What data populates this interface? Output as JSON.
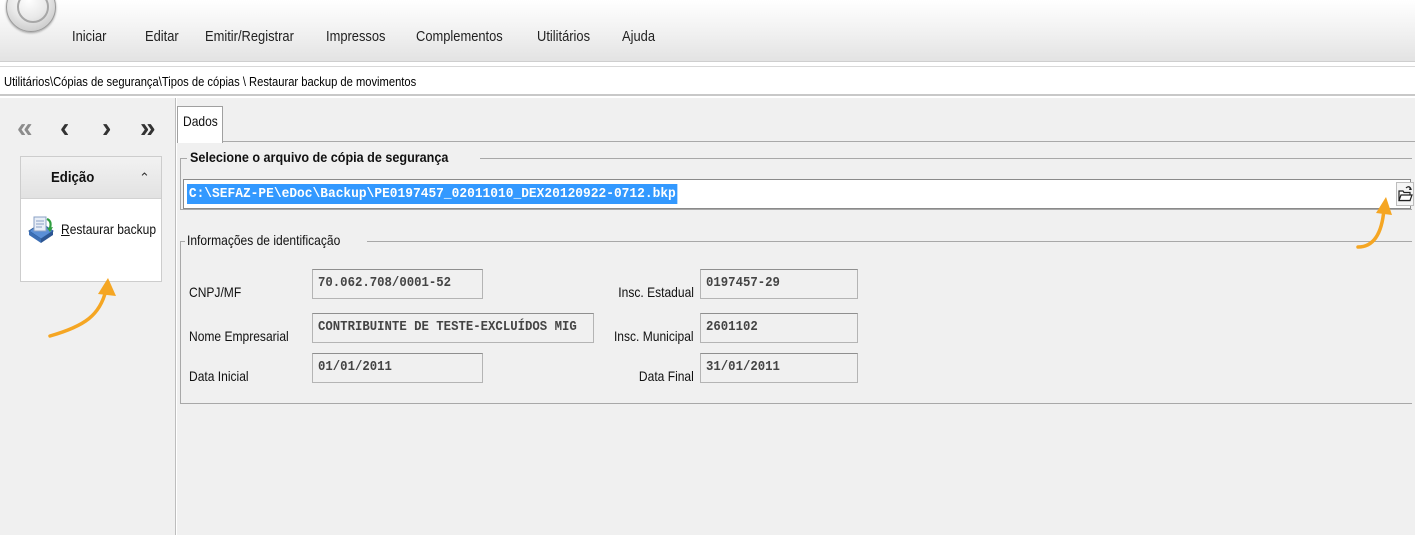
{
  "menu": {
    "items": [
      "Iniciar",
      "Editar",
      "Emitir/Registrar",
      "Impressos",
      "Complementos",
      "Utilitários",
      "Ajuda"
    ]
  },
  "breadcrumb": "Utilitários\\Cópias de segurança\\Tipos de cópias \\ Restaurar backup de movimentos",
  "nav": {
    "first_icon": "double-left-arrow-icon",
    "prev_icon": "left-arrow-icon",
    "next_icon": "right-arrow-icon",
    "last_icon": "double-right-arrow-icon"
  },
  "sidebar": {
    "group_title": "Edição",
    "collapse_icon": "double-chevron-up-icon",
    "actions": [
      {
        "label_first": "R",
        "label_rest": "estaurar backup",
        "icon": "restore-backup-icon"
      }
    ]
  },
  "tabs": [
    "Dados"
  ],
  "file_section": {
    "legend": "Selecione o arquivo de cópia de segurança",
    "file_path": "C:\\SEFAZ-PE\\eDoc\\Backup\\PE0197457_02011010_DEX20120922-0712.bkp",
    "browse_icon": "open-folder-icon"
  },
  "identification": {
    "legend": "Informações de identificação",
    "cnpj_label": "CNPJ/MF",
    "cnpj_value": "70.062.708/0001-52",
    "nome_label": "Nome Empresarial",
    "nome_value": "CONTRIBUINTE DE TESTE-EXCLUÍDOS MIG",
    "data_inicial_label": "Data Inicial",
    "data_inicial_value": "01/01/2011",
    "insc_estadual_label": "Insc. Estadual",
    "insc_estadual_value": "0197457-29",
    "insc_municipal_label": "Insc. Municipal",
    "insc_municipal_value": "2601102",
    "data_final_label": "Data Final",
    "data_final_value": "31/01/2011"
  },
  "colors": {
    "selection": "#3399ff",
    "annotation_arrow": "#f5a623",
    "panel_background": "#f0f0f0"
  }
}
